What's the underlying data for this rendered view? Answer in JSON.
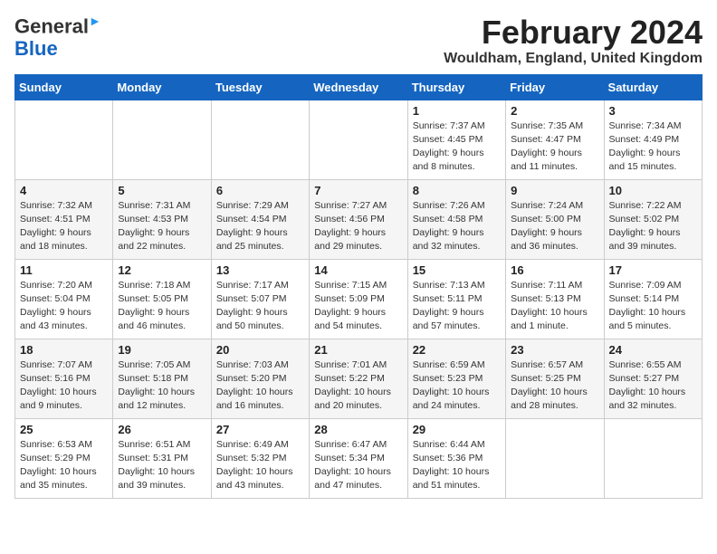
{
  "app": {
    "name_general": "General",
    "name_blue": "Blue"
  },
  "header": {
    "month_year": "February 2024",
    "location": "Wouldham, England, United Kingdom"
  },
  "days_of_week": [
    "Sunday",
    "Monday",
    "Tuesday",
    "Wednesday",
    "Thursday",
    "Friday",
    "Saturday"
  ],
  "weeks": [
    [
      {
        "day": "",
        "info": ""
      },
      {
        "day": "",
        "info": ""
      },
      {
        "day": "",
        "info": ""
      },
      {
        "day": "",
        "info": ""
      },
      {
        "day": "1",
        "info": "Sunrise: 7:37 AM\nSunset: 4:45 PM\nDaylight: 9 hours\nand 8 minutes."
      },
      {
        "day": "2",
        "info": "Sunrise: 7:35 AM\nSunset: 4:47 PM\nDaylight: 9 hours\nand 11 minutes."
      },
      {
        "day": "3",
        "info": "Sunrise: 7:34 AM\nSunset: 4:49 PM\nDaylight: 9 hours\nand 15 minutes."
      }
    ],
    [
      {
        "day": "4",
        "info": "Sunrise: 7:32 AM\nSunset: 4:51 PM\nDaylight: 9 hours\nand 18 minutes."
      },
      {
        "day": "5",
        "info": "Sunrise: 7:31 AM\nSunset: 4:53 PM\nDaylight: 9 hours\nand 22 minutes."
      },
      {
        "day": "6",
        "info": "Sunrise: 7:29 AM\nSunset: 4:54 PM\nDaylight: 9 hours\nand 25 minutes."
      },
      {
        "day": "7",
        "info": "Sunrise: 7:27 AM\nSunset: 4:56 PM\nDaylight: 9 hours\nand 29 minutes."
      },
      {
        "day": "8",
        "info": "Sunrise: 7:26 AM\nSunset: 4:58 PM\nDaylight: 9 hours\nand 32 minutes."
      },
      {
        "day": "9",
        "info": "Sunrise: 7:24 AM\nSunset: 5:00 PM\nDaylight: 9 hours\nand 36 minutes."
      },
      {
        "day": "10",
        "info": "Sunrise: 7:22 AM\nSunset: 5:02 PM\nDaylight: 9 hours\nand 39 minutes."
      }
    ],
    [
      {
        "day": "11",
        "info": "Sunrise: 7:20 AM\nSunset: 5:04 PM\nDaylight: 9 hours\nand 43 minutes."
      },
      {
        "day": "12",
        "info": "Sunrise: 7:18 AM\nSunset: 5:05 PM\nDaylight: 9 hours\nand 46 minutes."
      },
      {
        "day": "13",
        "info": "Sunrise: 7:17 AM\nSunset: 5:07 PM\nDaylight: 9 hours\nand 50 minutes."
      },
      {
        "day": "14",
        "info": "Sunrise: 7:15 AM\nSunset: 5:09 PM\nDaylight: 9 hours\nand 54 minutes."
      },
      {
        "day": "15",
        "info": "Sunrise: 7:13 AM\nSunset: 5:11 PM\nDaylight: 9 hours\nand 57 minutes."
      },
      {
        "day": "16",
        "info": "Sunrise: 7:11 AM\nSunset: 5:13 PM\nDaylight: 10 hours\nand 1 minute."
      },
      {
        "day": "17",
        "info": "Sunrise: 7:09 AM\nSunset: 5:14 PM\nDaylight: 10 hours\nand 5 minutes."
      }
    ],
    [
      {
        "day": "18",
        "info": "Sunrise: 7:07 AM\nSunset: 5:16 PM\nDaylight: 10 hours\nand 9 minutes."
      },
      {
        "day": "19",
        "info": "Sunrise: 7:05 AM\nSunset: 5:18 PM\nDaylight: 10 hours\nand 12 minutes."
      },
      {
        "day": "20",
        "info": "Sunrise: 7:03 AM\nSunset: 5:20 PM\nDaylight: 10 hours\nand 16 minutes."
      },
      {
        "day": "21",
        "info": "Sunrise: 7:01 AM\nSunset: 5:22 PM\nDaylight: 10 hours\nand 20 minutes."
      },
      {
        "day": "22",
        "info": "Sunrise: 6:59 AM\nSunset: 5:23 PM\nDaylight: 10 hours\nand 24 minutes."
      },
      {
        "day": "23",
        "info": "Sunrise: 6:57 AM\nSunset: 5:25 PM\nDaylight: 10 hours\nand 28 minutes."
      },
      {
        "day": "24",
        "info": "Sunrise: 6:55 AM\nSunset: 5:27 PM\nDaylight: 10 hours\nand 32 minutes."
      }
    ],
    [
      {
        "day": "25",
        "info": "Sunrise: 6:53 AM\nSunset: 5:29 PM\nDaylight: 10 hours\nand 35 minutes."
      },
      {
        "day": "26",
        "info": "Sunrise: 6:51 AM\nSunset: 5:31 PM\nDaylight: 10 hours\nand 39 minutes."
      },
      {
        "day": "27",
        "info": "Sunrise: 6:49 AM\nSunset: 5:32 PM\nDaylight: 10 hours\nand 43 minutes."
      },
      {
        "day": "28",
        "info": "Sunrise: 6:47 AM\nSunset: 5:34 PM\nDaylight: 10 hours\nand 47 minutes."
      },
      {
        "day": "29",
        "info": "Sunrise: 6:44 AM\nSunset: 5:36 PM\nDaylight: 10 hours\nand 51 minutes."
      },
      {
        "day": "",
        "info": ""
      },
      {
        "day": "",
        "info": ""
      }
    ]
  ]
}
